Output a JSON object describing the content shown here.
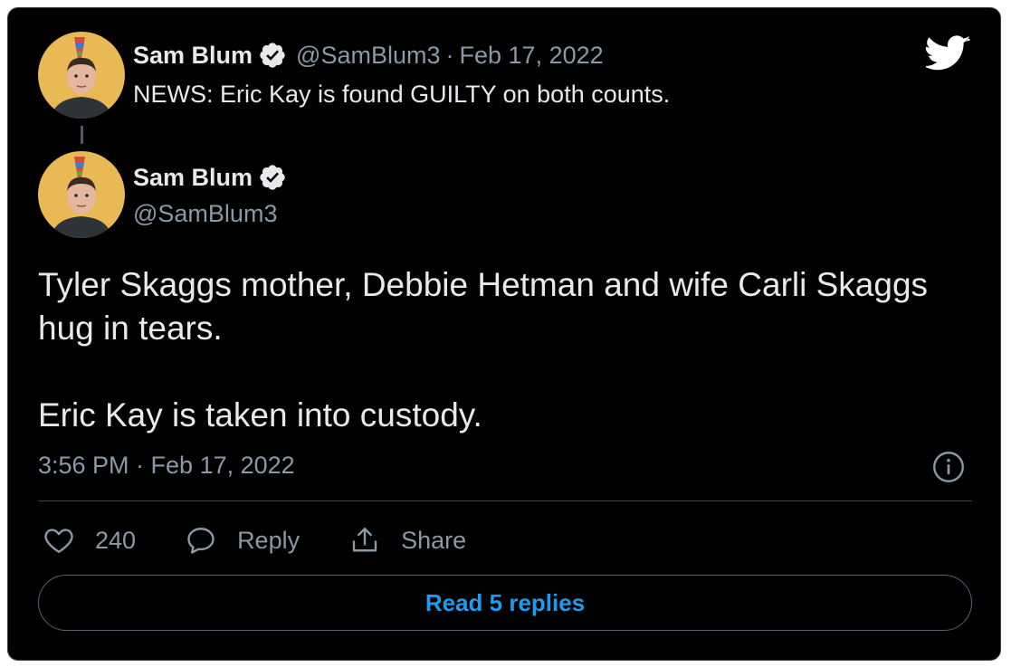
{
  "theme": {
    "background": "#000000",
    "text_primary": "#e7e9ea",
    "text_secondary": "#8b98a5",
    "accent": "#1d9bf0",
    "twitter_logo_color": "#ffffff"
  },
  "quoted_tweet": {
    "author_name": "Sam Blum",
    "handle": "@SamBlum3",
    "separator": "·",
    "date": "Feb 17, 2022",
    "text": "NEWS: Eric Kay is found GUILTY on both counts.",
    "verified": true
  },
  "main_tweet": {
    "author_name": "Sam Blum",
    "handle": "@SamBlum3",
    "verified": true,
    "paragraphs": [
      "Tyler Skaggs mother, Debbie Hetman and wife Carli Skaggs hug in tears.",
      "Eric Kay is taken into custody."
    ],
    "timestamp": "3:56 PM · Feb 17, 2022"
  },
  "actions": {
    "like_count": "240",
    "reply_label": "Reply",
    "share_label": "Share"
  },
  "read_replies_label": "Read 5 replies",
  "icons": {
    "brand": "twitter-bird-icon",
    "verified": "verified-badge-icon",
    "info": "info-icon",
    "like": "heart-icon",
    "reply": "speech-bubble-icon",
    "share": "share-upload-icon"
  }
}
